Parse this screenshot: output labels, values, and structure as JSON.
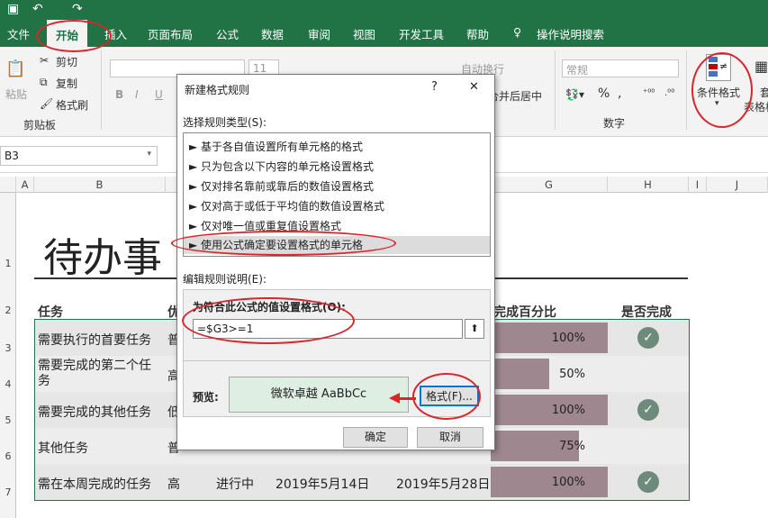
{
  "ribbon_tabs": [
    "文件",
    "开始",
    "插入",
    "页面布局",
    "公式",
    "数据",
    "审阅",
    "视图",
    "开发工具",
    "帮助",
    "操作说明搜索"
  ],
  "clipboard": {
    "cut": "剪切",
    "copy": "复制",
    "paste": "粘贴",
    "format_painter": "格式刷",
    "group": "剪贴板"
  },
  "ribbon": {
    "font_size": "11",
    "wrap_text": "自动换行",
    "merge_center": "合并后居中",
    "number_format": "常规",
    "number_group": "数字",
    "conditional_format": "条件格式",
    "table_format_partial": "套",
    "table_format_partial2": "表格格"
  },
  "name_box": "B3",
  "columns": [
    "A",
    "B",
    "G",
    "H",
    "I",
    "J"
  ],
  "rows": [
    "1",
    "2",
    "3",
    "4",
    "5",
    "6",
    "7"
  ],
  "sheet": {
    "title": "待办事",
    "headers": {
      "task": "任务",
      "priority": "优",
      "percent": "完成百分比",
      "done": "是否完成"
    },
    "tasks": [
      {
        "task": "需要执行的首要任务",
        "priority": "普",
        "percent": "100%",
        "fill": 1.0,
        "done": true
      },
      {
        "task": "需要完成的第二个任\n务",
        "priority": "高",
        "percent": "50%",
        "fill": 0.5,
        "done": false
      },
      {
        "task": "需要完成的其他任务",
        "priority": "低",
        "percent": "100%",
        "fill": 1.0,
        "done": true
      },
      {
        "task": "其他任务",
        "priority": "普",
        "percent": "75%",
        "fill": 0.75,
        "done": false
      },
      {
        "task": "需在本周完成的任务",
        "priority": "高",
        "status": "进行中",
        "start": "2019年5月14日",
        "end": "2019年5月28日",
        "percent": "100%",
        "fill": 1.0,
        "done": true
      }
    ]
  },
  "dialog": {
    "title": "新建格式规则",
    "help": "?",
    "close": "✕",
    "select_type_label": "选择规则类型(S):",
    "rule_types": [
      "► 基于各自值设置所有单元格的格式",
      "► 只为包含以下内容的单元格设置格式",
      "► 仅对排名靠前或靠后的数值设置格式",
      "► 仅对高于或低于平均值的数值设置格式",
      "► 仅对唯一值或重复值设置格式",
      "► 使用公式确定要设置格式的单元格"
    ],
    "edit_desc_label": "编辑规则说明(E):",
    "formula_label": "为符合此公式的值设置格式(O):",
    "formula_value": "=$G3>=1",
    "preview_label": "预览:",
    "preview_text": "微软卓越  AaBbCc",
    "format_button": "格式(F)...",
    "ok": "确定",
    "cancel": "取消"
  },
  "colors": {
    "excel_green": "#217346",
    "bar": "#9e878f",
    "check": "#6e8a7b",
    "annotation": "#d9252c"
  }
}
